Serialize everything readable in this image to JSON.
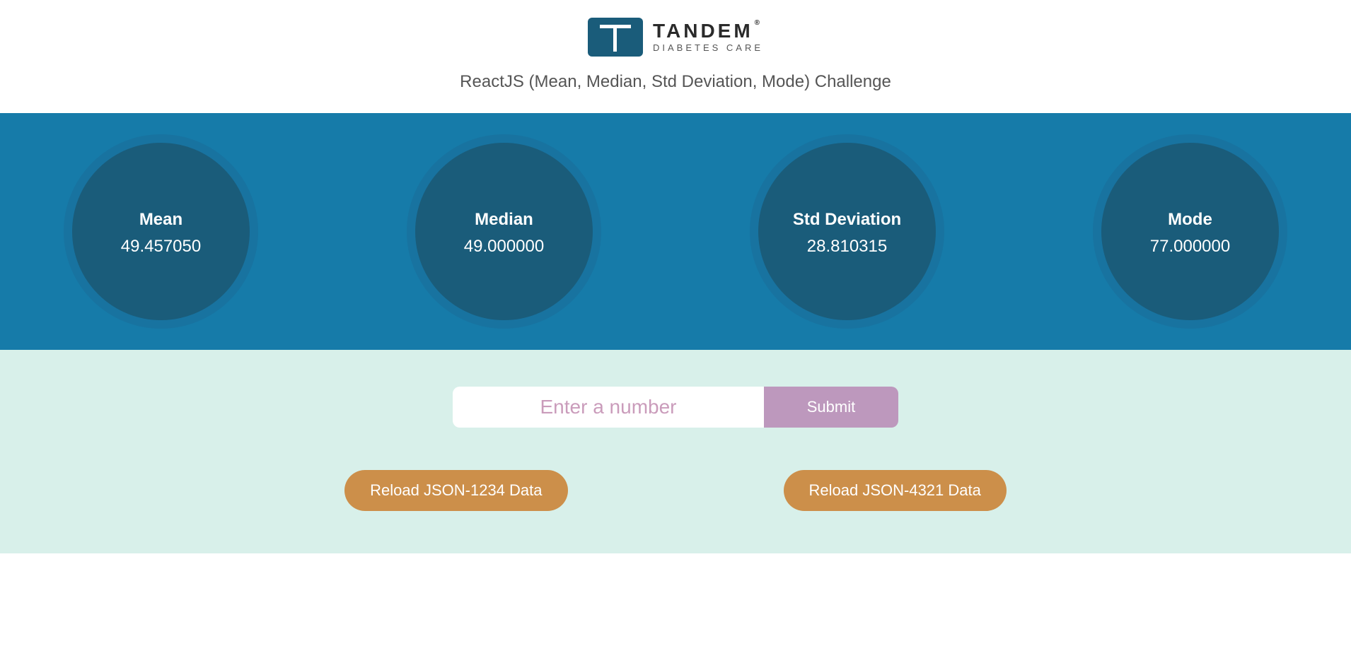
{
  "header": {
    "brand": "TANDEM",
    "brand_sub": "DIABETES CARE",
    "subtitle": "ReactJS (Mean, Median, Std Deviation, Mode) Challenge"
  },
  "stats": [
    {
      "label": "Mean",
      "value": "49.457050"
    },
    {
      "label": "Median",
      "value": "49.000000"
    },
    {
      "label": "Std Deviation",
      "value": "28.810315"
    },
    {
      "label": "Mode",
      "value": "77.000000"
    }
  ],
  "controls": {
    "input_placeholder": "Enter a number",
    "submit_label": "Submit",
    "reload1_label": "Reload JSON-1234 Data",
    "reload2_label": "Reload JSON-4321 Data"
  }
}
